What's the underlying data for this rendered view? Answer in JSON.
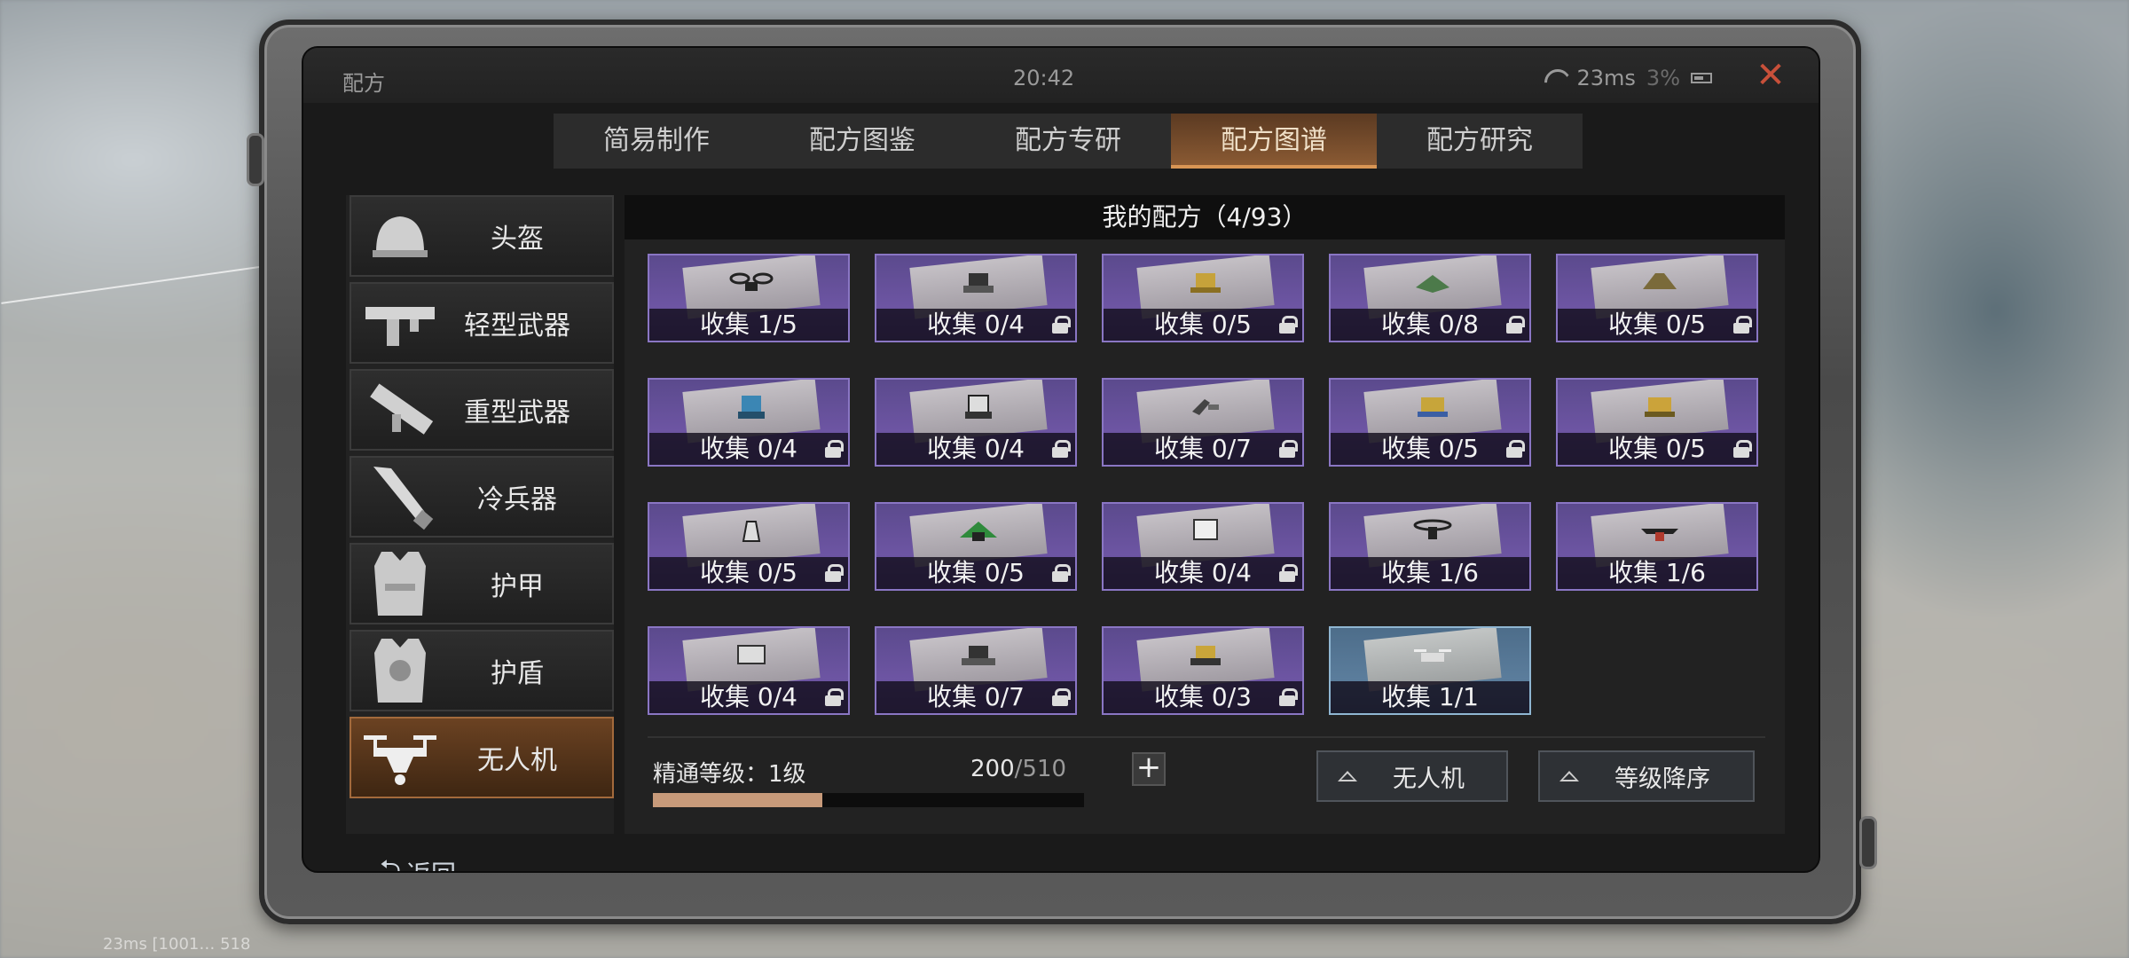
{
  "screen": {
    "title": "配方",
    "time": "20:42",
    "latency": "23ms",
    "battery": "3%"
  },
  "tabs": [
    {
      "label": "简易制作",
      "active": false
    },
    {
      "label": "配方图鉴",
      "active": false
    },
    {
      "label": "配方专研",
      "active": false
    },
    {
      "label": "配方图谱",
      "active": true
    },
    {
      "label": "配方研究",
      "active": false
    }
  ],
  "sidebar": {
    "items": [
      {
        "label": "头盔",
        "icon": "helmet-icon",
        "active": false
      },
      {
        "label": "轻型武器",
        "icon": "smg-icon",
        "active": false
      },
      {
        "label": "重型武器",
        "icon": "launcher-icon",
        "active": false
      },
      {
        "label": "冷兵器",
        "icon": "blade-icon",
        "active": false
      },
      {
        "label": "护甲",
        "icon": "armor-vest-icon",
        "active": false
      },
      {
        "label": "护盾",
        "icon": "shield-vest-icon",
        "active": false
      },
      {
        "label": "无人机",
        "icon": "drone-icon",
        "active": true
      }
    ]
  },
  "main": {
    "header": "我的配方（4/93）",
    "cards": [
      {
        "label": "收集 1/5",
        "locked": false,
        "color": "purple"
      },
      {
        "label": "收集 0/4",
        "locked": true,
        "color": "purple"
      },
      {
        "label": "收集 0/5",
        "locked": true,
        "color": "purple"
      },
      {
        "label": "收集 0/8",
        "locked": true,
        "color": "purple"
      },
      {
        "label": "收集 0/5",
        "locked": true,
        "color": "purple"
      },
      {
        "label": "收集 0/4",
        "locked": true,
        "color": "purple"
      },
      {
        "label": "收集 0/4",
        "locked": true,
        "color": "purple"
      },
      {
        "label": "收集 0/7",
        "locked": true,
        "color": "purple"
      },
      {
        "label": "收集 0/5",
        "locked": true,
        "color": "purple"
      },
      {
        "label": "收集 0/5",
        "locked": true,
        "color": "purple"
      },
      {
        "label": "收集 0/5",
        "locked": true,
        "color": "purple"
      },
      {
        "label": "收集 0/5",
        "locked": true,
        "color": "purple"
      },
      {
        "label": "收集 0/4",
        "locked": true,
        "color": "purple"
      },
      {
        "label": "收集 1/6",
        "locked": false,
        "color": "purple"
      },
      {
        "label": "收集 1/6",
        "locked": false,
        "color": "purple"
      },
      {
        "label": "收集 0/4",
        "locked": true,
        "color": "purple"
      },
      {
        "label": "收集 0/7",
        "locked": true,
        "color": "purple"
      },
      {
        "label": "收集 0/3",
        "locked": true,
        "color": "purple"
      },
      {
        "label": "收集 1/1",
        "locked": false,
        "color": "blue"
      }
    ],
    "mastery": {
      "label": "精通等级：1级",
      "current": "200",
      "max": "/510",
      "progress": 0.392
    },
    "filters": {
      "type_label": "无人机",
      "sort_label": "等级降序"
    }
  },
  "back_label": "返回",
  "debug_text": "23ms  [1001…                    518"
}
